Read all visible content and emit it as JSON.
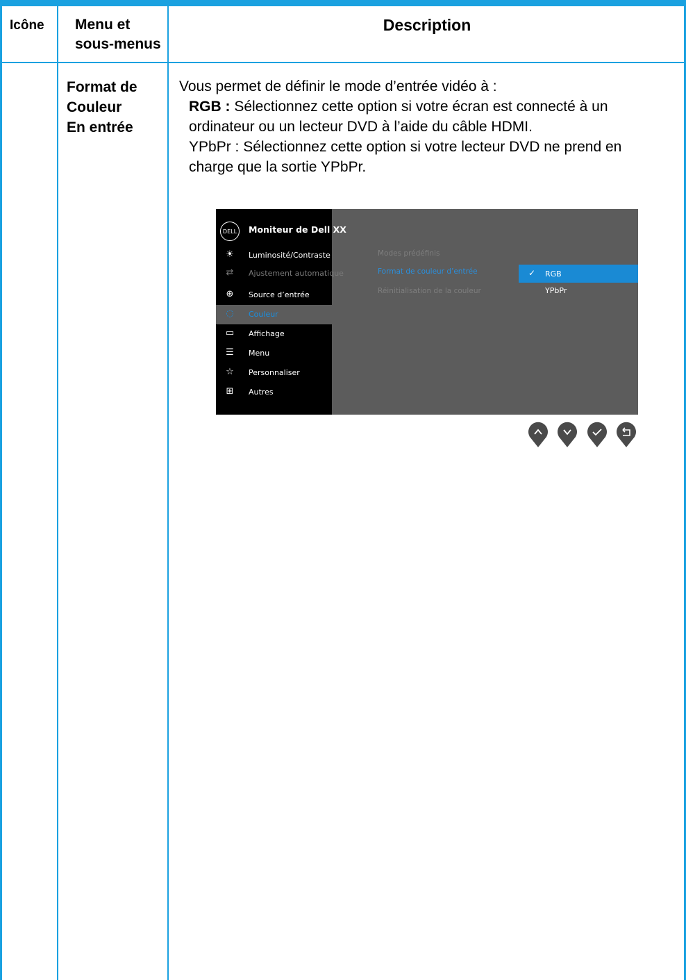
{
  "table": {
    "header": {
      "icon": "Icône",
      "menu_line1": "Menu et",
      "menu_line2": "sous-menus",
      "description": "Description"
    },
    "row": {
      "submenu_line1": "Format de",
      "submenu_line2": "Couleur",
      "submenu_line3": "En entrée",
      "desc_intro": "Vous permet de définir le mode d’entrée vidéo à :",
      "rgb_label": "RGB :",
      "rgb_text": " Sélectionnez cette option si votre écran est connecté à un",
      "rgb_text2": "ordinateur ou un lecteur DVD à l’aide du câble HDMI.",
      "ypbpr_text": "YPbPr : Sélectionnez cette option si votre lecteur DVD ne prend en",
      "ypbpr_text2": "charge que la sortie YPbPr."
    }
  },
  "osd": {
    "logo": "DELL",
    "title": "Moniteur de Dell XX",
    "menu_items": [
      {
        "label": "Luminosité/Contraste",
        "icon": "brightness-icon",
        "state": "normal"
      },
      {
        "label": "Ajustement automatique",
        "icon": "auto-adjust-icon",
        "state": "disabled"
      },
      {
        "label": "Source d’entrée",
        "icon": "input-source-icon",
        "state": "normal"
      },
      {
        "label": "Couleur",
        "icon": "color-icon",
        "state": "selected"
      },
      {
        "label": "Affichage",
        "icon": "display-icon",
        "state": "normal"
      },
      {
        "label": "Menu",
        "icon": "menu-icon",
        "state": "normal"
      },
      {
        "label": "Personnaliser",
        "icon": "star-icon",
        "state": "normal"
      },
      {
        "label": "Autres",
        "icon": "others-icon",
        "state": "normal"
      }
    ],
    "submenu": [
      "Modes prédéfinis",
      "Format de couleur d’entrée",
      "Réinitialisation de la couleur"
    ],
    "options": [
      {
        "label": "RGB",
        "selected": true
      },
      {
        "label": "YPbPr",
        "selected": false
      }
    ],
    "buttons": [
      "up-button",
      "down-button",
      "ok-button",
      "back-button"
    ]
  },
  "colors": {
    "border": "#1aa1e0",
    "osd_bg": "#5c5c5c",
    "osd_sidebar": "#000000",
    "osd_accent": "#1a8ad4",
    "button": "#4a4a4a"
  }
}
